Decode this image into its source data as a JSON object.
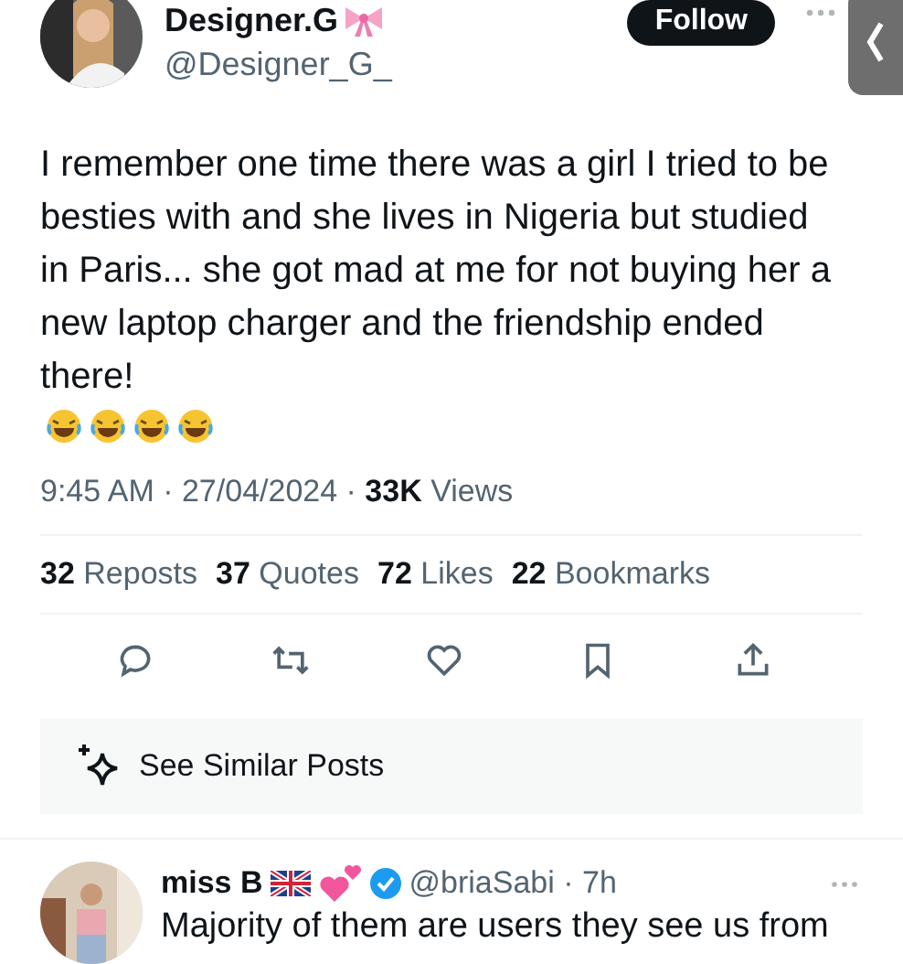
{
  "author": {
    "name": "Designer.G",
    "handle": "@Designer_G_"
  },
  "follow_button": "Follow",
  "tweet_text": "I remember one time there was a girl I tried to be besties with and she lives in Nigeria but studied in Paris... she got mad at me for not buying her a new laptop charger and the friendship ended there!",
  "meta": "9:45 AM · 27/04/2024 · **33K** Views",
  "stats": [
    "**32** Reposts",
    "**37** Quotes",
    "**72** Likes",
    "**22** Bookmarks"
  ],
  "similar_posts": "See Similar Posts",
  "reply": {
    "name": "miss B",
    "handle": "@briaSabi · 7h",
    "text": "Majority of them are users they see us from"
  }
}
